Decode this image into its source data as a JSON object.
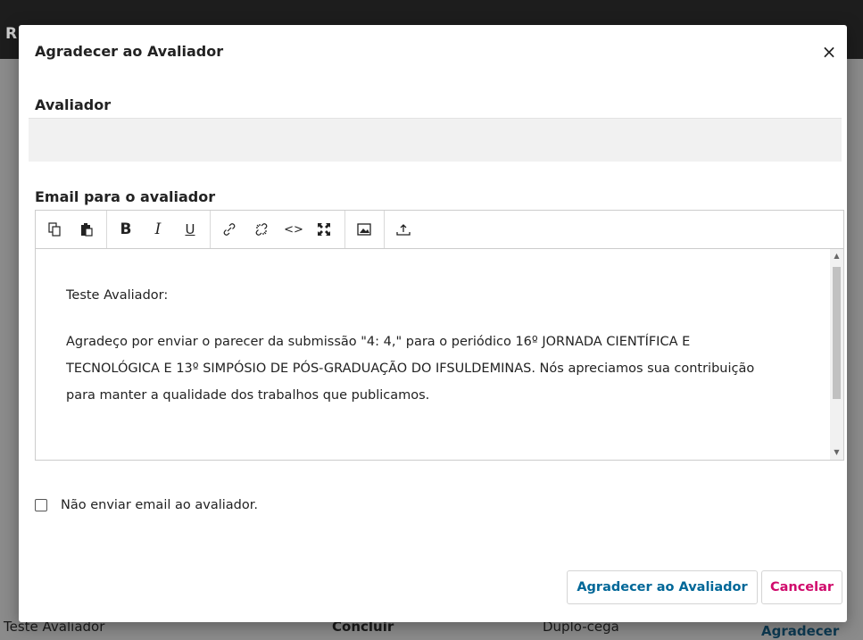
{
  "background": {
    "top_letter": "R",
    "bottom_row": {
      "name": "Teste Avaliador",
      "status": "Concluir",
      "method": "Duplo-cega",
      "action": "Agradecer"
    }
  },
  "modal": {
    "title": "Agradecer ao Avaliador",
    "close_symbol": "×",
    "reviewer_section_label": "Avaliador",
    "reviewer_value": "",
    "email_section_label": "Email para o avaliador",
    "toolbar_icons": [
      "copy-icon",
      "paste-icon",
      "bold-icon",
      "italic-icon",
      "underline-icon",
      "link-icon",
      "unlink-icon",
      "code-icon",
      "fullscreen-icon",
      "image-icon",
      "upload-icon"
    ],
    "toolbar_glyphs": {
      "bold": "B",
      "italic": "I",
      "underline": "U",
      "code": "<>"
    },
    "email_body": {
      "greeting": "Teste Avaliador:",
      "paragraph": "Agradeço por enviar o parecer da submissão \"4: 4,\" para o periódico 16º JORNADA CIENTÍFICA E TECNOLÓGICA E 13º SIMPÓSIO DE PÓS-GRADUAÇÃO DO IFSULDEMINAS. Nós apreciamos sua contribuição para manter a qualidade dos trabalhos que publicamos."
    },
    "skip_email_checkbox": {
      "label": "Não enviar email ao avaliador.",
      "checked": false
    },
    "buttons": {
      "submit": "Agradecer ao Avaliador",
      "cancel": "Cancelar"
    },
    "colors": {
      "primary": "#006798",
      "cancel": "#d00a6c"
    }
  }
}
